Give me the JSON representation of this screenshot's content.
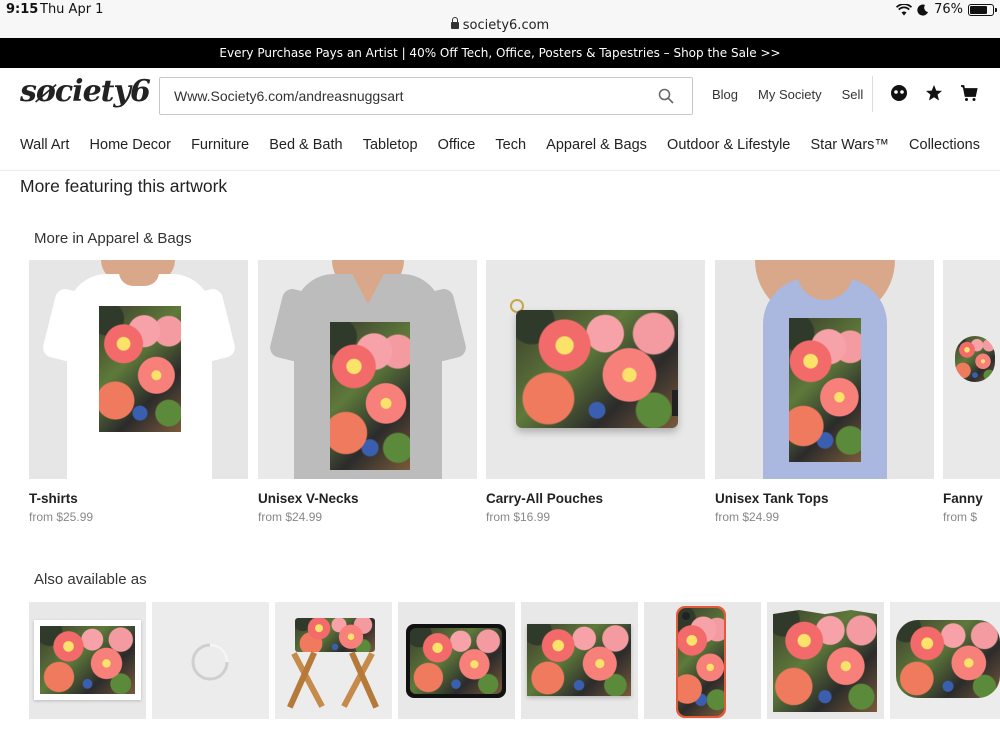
{
  "status_bar": {
    "time": "9:15",
    "date": "Thu Apr 1",
    "url": "society6.com",
    "battery": "76%",
    "battery_level": 0.76
  },
  "promo": {
    "text": "Every Purchase Pays an Artist | 40% Off Tech, Office, Posters & Tapestries – Shop the Sale >>"
  },
  "header": {
    "logo": "søciety6",
    "search_value": "Www.Society6.com/andreasnuggsart",
    "links": [
      "Blog",
      "My Society",
      "Sell"
    ],
    "icons": [
      "account-icon",
      "star-icon",
      "cart-icon"
    ]
  },
  "nav": {
    "items": [
      "Wall Art",
      "Home Decor",
      "Furniture",
      "Bed & Bath",
      "Tabletop",
      "Office",
      "Tech",
      "Apparel & Bags",
      "Outdoor & Lifestyle",
      "Star Wars™",
      "Collections"
    ]
  },
  "main": {
    "section_title": "More featuring this artwork",
    "apparel_title": "More in Apparel & Bags",
    "products": [
      {
        "name": "T-shirts",
        "price": "from $25.99"
      },
      {
        "name": "Unisex V-Necks",
        "price": "from $24.99"
      },
      {
        "name": "Carry-All Pouches",
        "price": "from $16.99"
      },
      {
        "name": "Unisex Tank Tops",
        "price": "from $24.99"
      },
      {
        "name": "Fanny",
        "price": "from $"
      }
    ],
    "also_title": "Also available as"
  },
  "colors": {
    "promo_bg": "#000000",
    "text": "#222222",
    "price": "#888888"
  }
}
